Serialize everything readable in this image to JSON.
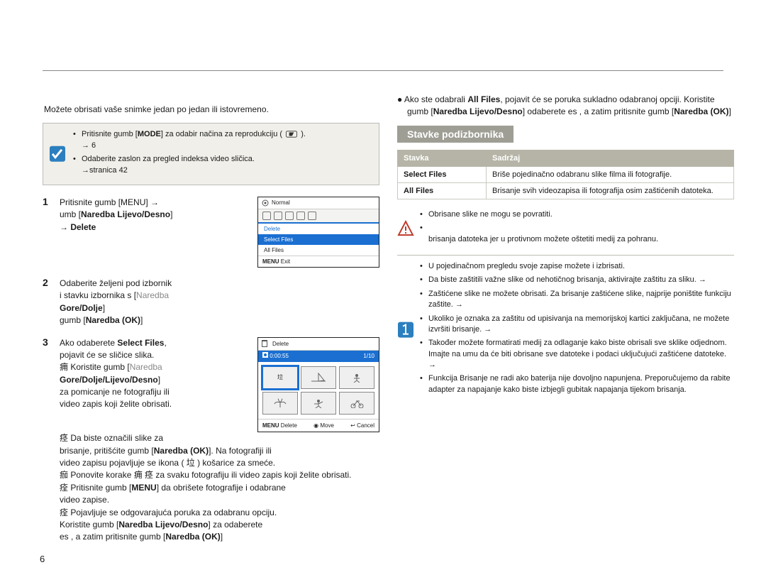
{
  "header_right": " ",
  "page_number": "6 ",
  "hr": true,
  "left": {
    "chapter_title": " ",
    "intro": "Možete obrisati vaše snimke jedan po jedan ili istovremeno.",
    "prebox": {
      "item1_a": "Pritisnite gumb [",
      "item1_b": "MODE",
      "item1_c": "] za odabir načina za reprodukciju (",
      "item1_d": ").",
      "item1_e": "→ 6",
      "item2_a": "Odaberite zaslon za pregled indeksa video sličica.",
      "item2_b": "→stranica 42"
    },
    "steps": [
      {
        "n": "1",
        "l1": "Pritisnite gumb [MENU]  →",
        "l2_a": " umb [",
        "l2_b": "Naredba Lijevo/Desno",
        "l2_c": "]",
        "l3": "→ Delete "
      },
      {
        "n": "2",
        "l1_a": "Odaberite željeni pod izbornik",
        "l1_b": "i stavku izbornika s [",
        "l1_c": "Naredba",
        "l2_b": "Gore/Dolje",
        "l2_c": "] ",
        "l3_a": "gumb [",
        "l3_b": "Naredba (OK)",
        "l3_c": "] "
      },
      {
        "n": "3",
        "l1_a": "Ako odaberete ",
        "l1_b": "Select Files",
        "l1_c": ",",
        "l2": "pojavit će se sličice slika.",
        "b1_a": "痈 Koristite gumb [",
        "b1_b": "Naredba",
        "b2_b": "Gore/Dolje/Lijevo/Desno",
        "b2_c": "]",
        "b3": "za pomicanje ne fotografiju ili",
        "b4": "video zapis koji želite obrisati.",
        "b5_a": "痉 Da biste označili slike za",
        "b5_b": "brisanje, pritišćite gumb [",
        "b5_c": "Naredba (OK)",
        "b5_d": "]. Na fotografiji ili",
        "b6": "video zapisu pojavljuje se ikona ( 垃 ) košarice za smeće.",
        "b7": "痂 Ponovite korake 痈  痉 za svaku fotografiju ili video zapis koji želite obrisati.",
        "b8_a": "痊 Pritisnite gumb [",
        "b8_b": "MENU",
        "b8_c": "] da obrišete fotografije i odabrane",
        "b9": "video zapise.",
        "b10": "痊 Pojavljuje se odgovarajuća poruka za odabranu opciju.",
        "b11_a": "Koristite gumb [",
        "b11_b": "Naredba Lijevo/Desno",
        "b11_c": "] za odaberete",
        "b12_a": " es , a zatim pritisnite gumb [",
        "b12_b": "Naredba (OK)",
        "b12_c": "] "
      }
    ],
    "fig1": {
      "title": "Normal",
      "items": [
        "Delete",
        "Select Files",
        "All Files"
      ],
      "footer_menu": "MENU",
      "footer_exit": "Exit"
    },
    "fig2": {
      "title": "Delete",
      "time": "0:00:55",
      "counter": "1/10",
      "thumb_mark": "垃",
      "footer": {
        "del": {
          "b": "MENU",
          "t": "Delete"
        },
        "move": "Move",
        "cancel": "Cancel"
      }
    }
  },
  "right": {
    "top_para_a": "●  Ako ste odabrali ",
    "top_para_b": "All Files",
    "top_para_c": ", pojavit će se poruka sukladno odabranoj opciji. Koristite gumb [",
    "top_para_d": "Naredba Lijevo/Desno",
    "top_para_e": "]  odaberete  es , a zatim pritisnite gumb [",
    "top_para_f": "Naredba (OK)",
    "top_para_g": "] ",
    "subheading": "Stavke podizbornika",
    "table": {
      "h1": "Stavka",
      "h2": "Sadržaj",
      "rows": [
        {
          "k": "Select Files",
          "v": "Briše pojedinačno odabranu slike filma ili fotografije."
        },
        {
          "k": "All Files",
          "v": "Brisanje svih videozapisa ili fotografija osim zaštićenih datoteka."
        }
      ]
    },
    "warn": {
      "i1": "Obrisane slike ne mogu se povratiti.",
      "i2": " ",
      "i3": "brisanja datoteka jer u protivnom možete oštetiti medij za pohranu."
    },
    "tip": {
      "i1": "U pojedinačnom pregledu svoje zapise možete i izbrisati.",
      "i2": "Da biste zaštitili važne slike od nehotičnog brisanja, aktivirajte zaštitu za sliku. → ",
      "i3": "Zaštićene slike ne možete obrisati. Za brisanje zaštićene slike, najprije poništite funkciju zaštite. → ",
      "i4": "Ukoliko je oznaka za zaštitu od upisivanja na memorijskoj kartici zaključana, ne možete izvršiti brisanje. → ",
      "i5": "Također možete formatirati medij za odlaganje kako biste obrisali sve sklike odjednom. Imajte na umu da će biti obrisane sve datoteke i podaci uključujući zaštićene datoteke. → ",
      "i6": "Funkcija Brisanje ne radi ako baterija nije dovoljno napunjena. Preporučujemo da rabite adapter za napajanje kako biste izbjegli gubitak napajanja tijekom brisanja."
    }
  }
}
